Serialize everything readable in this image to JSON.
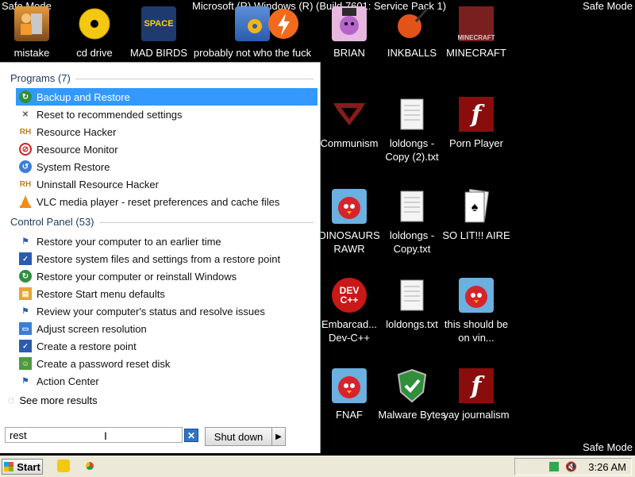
{
  "system": {
    "safe_mode_label": "Safe Mode",
    "title_bar": "Microsoft (R) Windows (R) (Build 7601: Service Pack 1)"
  },
  "desktop": {
    "top_icons": [
      {
        "label": "mistake",
        "icon": "user-computer-icon"
      },
      {
        "label": "cd drive",
        "icon": "cd-drive-icon"
      },
      {
        "label": "MAD BIRDS",
        "icon": "angry-birds-space-icon"
      },
      {
        "label": "probably not who the fuck",
        "icon": "monitor-gears-icon"
      },
      {
        "label": "",
        "icon": "avast-icon"
      },
      {
        "label": "BRIAN",
        "icon": "game-character-icon"
      },
      {
        "label": "INKBALLS",
        "icon": "inkball-icon"
      },
      {
        "label": "MINECRAFT",
        "icon": "minecraft-icon"
      }
    ],
    "grid_icons": [
      {
        "label": "Communism",
        "icon": "papers-please-icon"
      },
      {
        "label": "loldongs - Copy (2).txt",
        "icon": "text-file-icon"
      },
      {
        "label": "Porn Player",
        "icon": "flash-player-icon"
      },
      {
        "label": "DINOSAURS RAWR",
        "icon": "angry-birds-icon"
      },
      {
        "label": "loldongs - Copy.txt",
        "icon": "text-file-icon"
      },
      {
        "label": "SO LIT!!! AIRE",
        "icon": "solitaire-icon"
      },
      {
        "label": "Embarcad... Dev-C++",
        "icon": "dev-cpp-icon"
      },
      {
        "label": "loldongs.txt",
        "icon": "text-file-icon"
      },
      {
        "label": "this should be on vin...",
        "icon": "angry-birds-icon"
      },
      {
        "label": "FNAF",
        "icon": "angry-birds-icon"
      },
      {
        "label": "Malware Bytes",
        "icon": "malwarebytes-shield-icon"
      },
      {
        "label": "yay journalism",
        "icon": "flash-player-icon"
      }
    ]
  },
  "start_menu": {
    "programs_header": "Programs (7)",
    "programs": [
      {
        "label": "Backup and Restore",
        "selected": true
      },
      {
        "label": "Reset to recommended settings",
        "selected": false
      },
      {
        "label": "Resource Hacker",
        "selected": false
      },
      {
        "label": "Resource Monitor",
        "selected": false
      },
      {
        "label": "System Restore",
        "selected": false
      },
      {
        "label": "Uninstall Resource Hacker",
        "selected": false
      },
      {
        "label": "VLC media player - reset preferences and cache files",
        "selected": false
      }
    ],
    "control_panel_header": "Control Panel (53)",
    "control_panel": [
      {
        "label": "Restore your computer to an earlier time"
      },
      {
        "label": "Restore system files and settings from a restore point"
      },
      {
        "label": "Restore your computer or reinstall Windows"
      },
      {
        "label": "Restore Start menu defaults"
      },
      {
        "label": "Review your computer's status and resolve issues"
      },
      {
        "label": "Adjust screen resolution"
      },
      {
        "label": "Create a restore point"
      },
      {
        "label": "Create a password reset disk"
      },
      {
        "label": "Action Center"
      }
    ],
    "see_more": "See more results",
    "search_value": "rest",
    "shutdown_label": "Shut down"
  },
  "taskbar": {
    "start_label": "Start",
    "clock": "3:26 AM"
  },
  "colors": {
    "selection": "#3399ff",
    "desktop_bg": "#000000",
    "taskbar_bg": "#ece9d8"
  }
}
